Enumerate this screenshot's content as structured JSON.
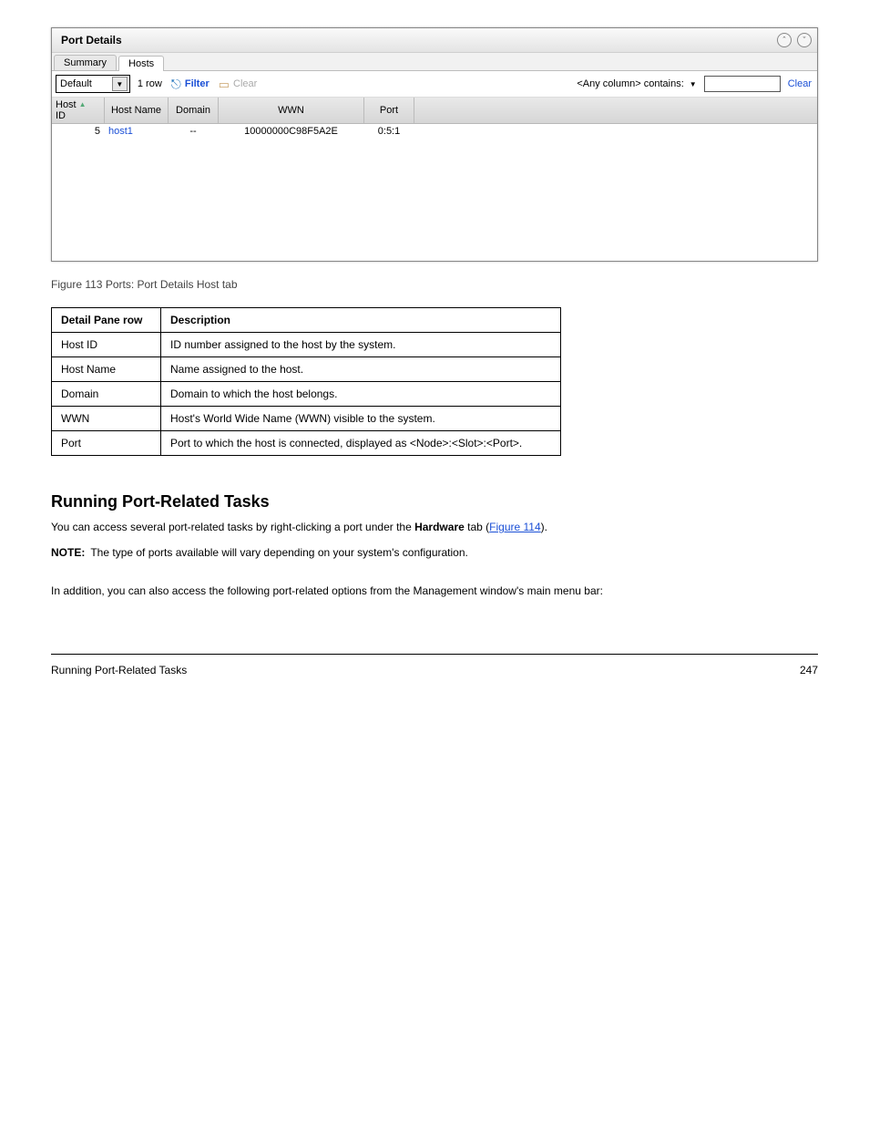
{
  "screenshot": {
    "title": "Port Details",
    "tabs": [
      "Summary",
      "Hosts"
    ],
    "active_tab": 1,
    "toolbar": {
      "dropdown_value": "Default",
      "row_count": "1 row",
      "filter_label": "Filter",
      "clear_label": "Clear",
      "anycol_label": "<Any column> contains:",
      "clear_link": "Clear"
    },
    "columns": [
      {
        "key": "host_id",
        "label_line1": "Host",
        "label_line2": "ID",
        "sort": true
      },
      {
        "key": "host_name",
        "label": "Host Name"
      },
      {
        "key": "domain",
        "label": "Domain"
      },
      {
        "key": "wwn",
        "label": "WWN"
      },
      {
        "key": "port",
        "label": "Port"
      }
    ],
    "rows": [
      {
        "host_id": "5",
        "host_name": "host1",
        "domain": "--",
        "wwn": "10000000C98F5A2E",
        "port": "0:5:1"
      }
    ]
  },
  "fig_caption": "Figure 113  Ports: Port Details Host tab",
  "detail_table": {
    "head": [
      "Detail Pane row",
      "Description"
    ],
    "rows": [
      [
        "Host ID",
        "ID number assigned to the host by the system."
      ],
      [
        "Host Name",
        "Name assigned to the host."
      ],
      [
        "Domain",
        "Domain to which the host belongs."
      ],
      [
        "WWN",
        "Host's World Wide Name (WWN) visible to the system."
      ],
      [
        "Port",
        "Port to which the host is connected, displayed as <Node>:<Slot>:<Port>."
      ]
    ]
  },
  "section": {
    "heading": "Running Port-Related Tasks",
    "p1_prefix": "You can access several port-related tasks by right-clicking a port under the ",
    "p1_bold": "Hardware",
    "p1_suffix": " tab (",
    "p1_link": "Figure 114",
    "p1_tail": ").",
    "p2": "In addition, you can also access the following port-related options from the Management window's main menu bar:",
    "note_label": "NOTE:",
    "note_text": "The type of ports available will vary depending on your system's configuration."
  },
  "footer": {
    "left": "Running Port-Related Tasks",
    "right": "247"
  }
}
